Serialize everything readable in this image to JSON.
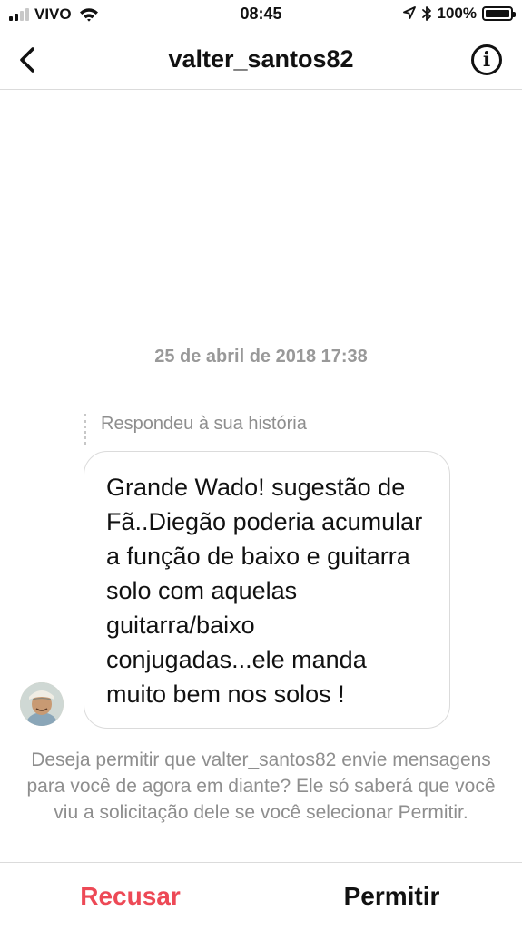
{
  "status_bar": {
    "carrier": "VIVO",
    "time": "08:45",
    "battery_percent": "100%",
    "signal_bars": 2,
    "signal_total": 4,
    "battery_level": 1.0
  },
  "nav": {
    "title": "valter_santos82",
    "back_icon": "chevron-left-icon",
    "info_icon": "info-icon",
    "info_glyph": "i"
  },
  "conversation": {
    "timestamp": "25 de abril de 2018 17:38",
    "reply_label": "Respondeu à sua história",
    "message": "Grande Wado! sugestão de Fã..Diegão poderia acumular a função de baixo e guitarra solo com aquelas guitarra/baixo conjugadas...ele manda muito bem nos solos !"
  },
  "permission": {
    "text": "Deseja permitir que valter_santos82 envie mensagens para você de agora em diante? Ele só saberá que você viu a solicitação dele se você selecionar Permitir."
  },
  "actions": {
    "decline_label": "Recusar",
    "allow_label": "Permitir"
  },
  "colors": {
    "decline": "#ed4956",
    "secondary_text": "#8e8e8e",
    "border": "#dbdbdb"
  }
}
